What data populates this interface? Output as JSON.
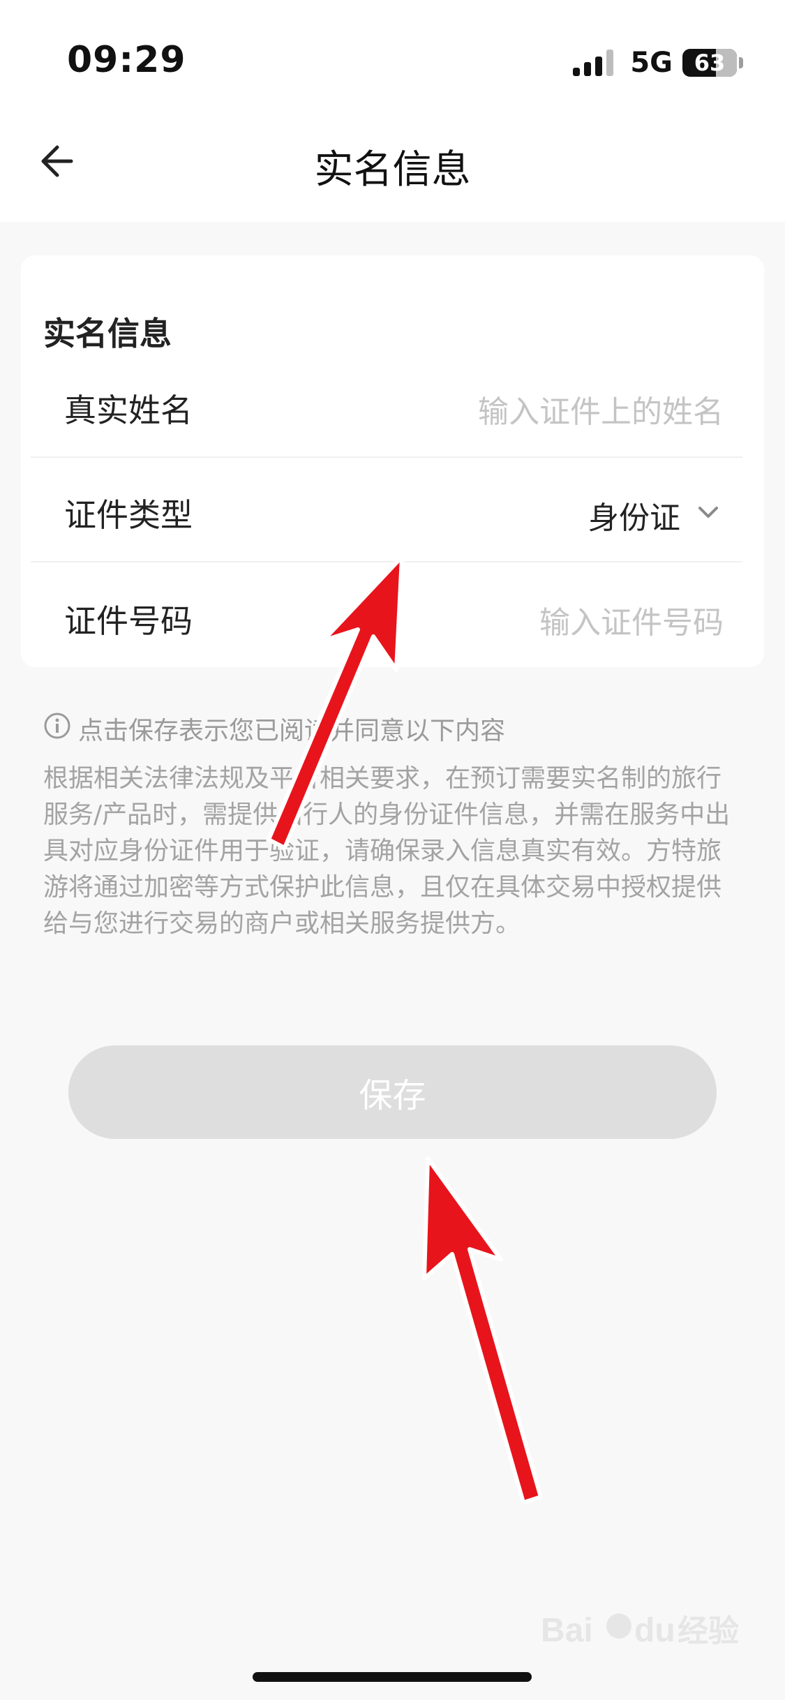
{
  "status_bar": {
    "time": "09:29",
    "network": "5G",
    "battery": "63"
  },
  "header": {
    "title": "实名信息",
    "back_icon": "back-arrow-icon"
  },
  "form": {
    "section_title": "实名信息",
    "name_label": "真实姓名",
    "name_placeholder": "输入证件上的姓名",
    "id_type_label": "证件类型",
    "id_type_value": "身份证",
    "id_number_label": "证件号码",
    "id_number_placeholder": "输入证件号码"
  },
  "notice": {
    "heading": "点击保存表示您已阅读并同意以下内容",
    "body": "根据相关法律法规及平台相关要求，在预订需要实名制的旅行服务/产品时，需提供出行人的身份证件信息，并需在服务中出具对应身份证件用于验证，请确保录入信息真实有效。方特旅游将通过加密等方式保护此信息，且仅在具体交易中授权提供给与您进行交易的商户或相关服务提供方。"
  },
  "actions": {
    "save_label": "保存"
  },
  "watermark": "Baidu经验",
  "colors": {
    "annotation_arrow": "#e8141c",
    "save_button_disabled": "#dedede"
  }
}
